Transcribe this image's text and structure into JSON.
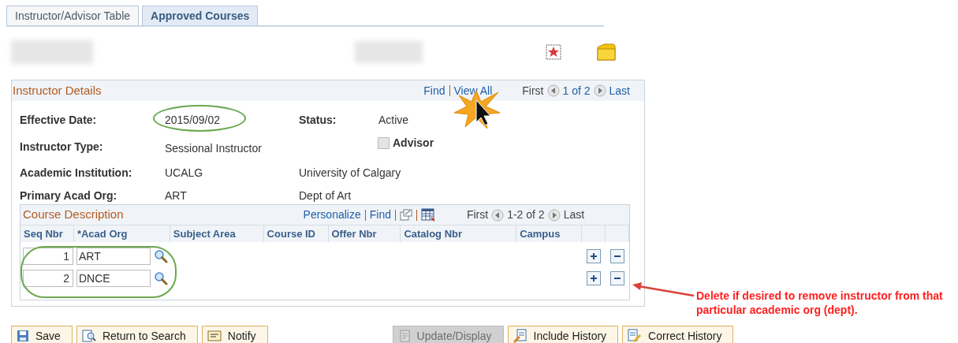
{
  "tabs": [
    {
      "label": "Instructor/Advisor Table",
      "selected": false
    },
    {
      "label": "Approved Courses",
      "selected": true
    }
  ],
  "instructor_details": {
    "title": "Instructor Details",
    "find": "Find",
    "view_all": "View All",
    "first": "First",
    "count": "1 of 2",
    "last": "Last",
    "effective_date": {
      "label": "Effective Date:",
      "value": "2015/09/02"
    },
    "status": {
      "label": "Status:",
      "value": "Active"
    },
    "instructor_type": {
      "label": "Instructor Type:",
      "value": "Sessional Instructor"
    },
    "advisor": {
      "label": "Advisor",
      "checked": false
    },
    "academic_institution": {
      "label": "Academic Institution:",
      "code": "UCALG",
      "description": "University of Calgary"
    },
    "primary_acad_org": {
      "label": "Primary Acad Org:",
      "code": "ART",
      "description": "Dept of Art"
    }
  },
  "course_description": {
    "title": "Course Description",
    "personalize": "Personalize",
    "find": "Find",
    "first": "First",
    "count": "1-2 of 2",
    "last": "Last",
    "columns": [
      "Seq Nbr",
      "*Acad Org",
      "Subject Area",
      "Course ID",
      "Offer Nbr",
      "Catalog Nbr",
      "Campus"
    ],
    "rows": [
      {
        "seq_nbr": "1",
        "acad_org": "ART"
      },
      {
        "seq_nbr": "2",
        "acad_org": "DNCE"
      }
    ]
  },
  "buttons": [
    {
      "kind": "save",
      "label": "Save",
      "disabled": false
    },
    {
      "kind": "search",
      "label": "Return to Search",
      "disabled": false
    },
    {
      "kind": "notify",
      "label": "Notify",
      "disabled": false
    },
    {
      "kind": "update",
      "label": "Update/Display",
      "disabled": true
    },
    {
      "kind": "include",
      "label": "Include History",
      "disabled": false
    },
    {
      "kind": "correct",
      "label": "Correct History",
      "disabled": false
    }
  ],
  "annotation": {
    "text": "Delete if desired to remove instructor from that particular academic org (dept)."
  }
}
